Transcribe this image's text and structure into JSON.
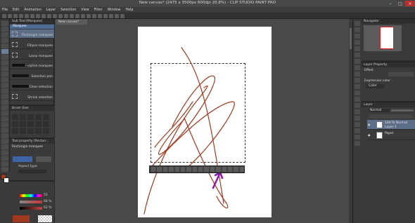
{
  "window": {
    "title": "New canvas* (2475 x 3500px 600dpi 20.8%) - CLIP STUDIO PAINT PRO"
  },
  "menu": [
    "File",
    "Edit",
    "Animation",
    "Layer",
    "Selection",
    "View",
    "Filter",
    "Window",
    "Help"
  ],
  "doc_tab": "New canvas*",
  "sub_tool": {
    "header": "Sub Tool [Marquee]",
    "tab": "Marquee",
    "items": [
      "Rectangle marquee",
      "Ellipse marquee",
      "Lasso marquee",
      "Polyline marquee",
      "Selection pen",
      "Clear selection",
      "Shrink selection"
    ]
  },
  "brush_size": {
    "header": "Brush Size"
  },
  "tool_property": {
    "header": "Tool property [Rectan...",
    "tool_name": "Rectangle marquee",
    "aspect_label": "Aspect type"
  },
  "color_sliders": {
    "values": [
      "55",
      "68 %",
      "62 %"
    ]
  },
  "navigator": {
    "header": "Navigator"
  },
  "layer_property": {
    "header": "Layer Property",
    "effect_label": "Effect",
    "expression_label": "Expression color",
    "expression_value": "Color"
  },
  "layer_panel": {
    "header": "Layer",
    "blend_mode": "Normal",
    "layers": [
      {
        "line1": "100 % Normal",
        "line2": "Layer 1"
      },
      {
        "line1": "Paper",
        "line2": ""
      }
    ]
  },
  "colors": {
    "stroke": "#a0391f",
    "accent_purple": "#8a1aa8",
    "selected": "#5d6f88"
  }
}
